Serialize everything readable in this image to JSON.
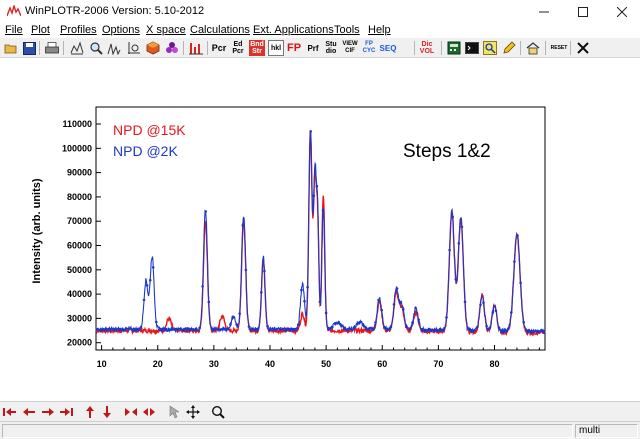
{
  "window": {
    "title": "WinPLOTR-2006 Version: 5.10-2012",
    "controls": [
      "minimize",
      "maximize",
      "close"
    ]
  },
  "menu": [
    {
      "label": "File"
    },
    {
      "label": "Plot"
    },
    {
      "label": "Profiles"
    },
    {
      "label": "Options"
    },
    {
      "label": "X space"
    },
    {
      "label": "Calculations"
    },
    {
      "label": "Ext. Applications"
    },
    {
      "label": "Tools"
    },
    {
      "label": "Help"
    }
  ],
  "toolbar": {
    "buttons": [
      {
        "name": "open-icon"
      },
      {
        "name": "save-icon"
      },
      {
        "name": "print-icon"
      },
      {
        "name": "zoom-graph-icon"
      },
      {
        "name": "zoom-icon"
      },
      {
        "name": "peaks-icon"
      },
      {
        "name": "cube-icon"
      },
      {
        "name": "molecule-icon"
      },
      {
        "name": "bars-icon"
      },
      {
        "name": "pcr-icon",
        "text": "Pcr"
      },
      {
        "name": "edit-pcr-icon",
        "text": "Ed Pcr"
      },
      {
        "name": "bond-str-icon",
        "text": "Bnd Str"
      },
      {
        "name": "hkl-icon",
        "text": "hkl"
      },
      {
        "name": "fp-icon",
        "text": "FP"
      },
      {
        "name": "prf-icon",
        "text": "Prf"
      },
      {
        "name": "studio-icon",
        "text": "Stu dio"
      },
      {
        "name": "view-cif-icon",
        "text": "VIEW CIF"
      },
      {
        "name": "fp-cyc-icon",
        "text": "FP CYC"
      },
      {
        "name": "seq-icon",
        "text": "SEQ"
      },
      {
        "name": "dic-vol-icon",
        "text": "Dic VOL"
      },
      {
        "name": "calculator-icon"
      },
      {
        "name": "terminal-icon"
      },
      {
        "name": "search-icon"
      },
      {
        "name": "pencil-icon"
      },
      {
        "name": "home-icon"
      },
      {
        "name": "reset-icon",
        "text": "RESET"
      },
      {
        "name": "close-x-icon"
      }
    ]
  },
  "chart_data": {
    "type": "line",
    "ylabel": "Intensity (arb. units)",
    "xlabel": "",
    "xlim": [
      9,
      89
    ],
    "ylim": [
      17000,
      117000
    ],
    "xticks": [
      10,
      20,
      30,
      40,
      50,
      60,
      70,
      80
    ],
    "yticks": [
      20000,
      30000,
      40000,
      50000,
      60000,
      70000,
      80000,
      90000,
      100000,
      110000
    ],
    "grid": false,
    "annotation": "Steps 1&2",
    "legend_position": "top-left",
    "series": [
      {
        "name": "NPD @15K",
        "color": "#e8161c",
        "baseline": 25000,
        "peaks": [
          [
            28.5,
            45000,
            0.35
          ],
          [
            35.3,
            46000,
            0.35
          ],
          [
            38.8,
            30000,
            0.3
          ],
          [
            45.8,
            7000,
            0.35
          ],
          [
            47.2,
            82000,
            0.28
          ],
          [
            48.0,
            62000,
            0.25
          ],
          [
            48.5,
            42000,
            0.22
          ],
          [
            49.5,
            56000,
            0.25
          ],
          [
            59.5,
            12000,
            0.4
          ],
          [
            62.5,
            16000,
            0.4
          ],
          [
            63.5,
            9000,
            0.4
          ],
          [
            66.0,
            8000,
            0.4
          ],
          [
            72.4,
            49000,
            0.45
          ],
          [
            74.0,
            46000,
            0.45
          ],
          [
            77.8,
            15000,
            0.4
          ],
          [
            80.0,
            11000,
            0.4
          ],
          [
            84.0,
            40000,
            0.55
          ],
          [
            22.0,
            5000,
            0.4
          ],
          [
            31.5,
            6000,
            0.4
          ]
        ]
      },
      {
        "name": "NPD @2K",
        "color": "#1c39c9",
        "baseline": 25500,
        "peaks": [
          [
            17.9,
            20000,
            0.35
          ],
          [
            19.0,
            30000,
            0.35
          ],
          [
            28.5,
            49000,
            0.35
          ],
          [
            35.3,
            47000,
            0.35
          ],
          [
            38.8,
            30000,
            0.3
          ],
          [
            45.8,
            19000,
            0.35
          ],
          [
            47.2,
            82000,
            0.28
          ],
          [
            48.0,
            64000,
            0.25
          ],
          [
            48.5,
            44000,
            0.22
          ],
          [
            49.5,
            50000,
            0.25
          ],
          [
            33.5,
            5000,
            0.4
          ],
          [
            59.5,
            13000,
            0.4
          ],
          [
            62.5,
            17000,
            0.4
          ],
          [
            63.5,
            10000,
            0.4
          ],
          [
            66.0,
            9000,
            0.4
          ],
          [
            72.4,
            49000,
            0.45
          ],
          [
            74.0,
            47000,
            0.45
          ],
          [
            77.8,
            14000,
            0.4
          ],
          [
            80.0,
            10000,
            0.4
          ],
          [
            84.0,
            40000,
            0.55
          ],
          [
            52.0,
            3000,
            0.6
          ],
          [
            56.0,
            3000,
            0.6
          ]
        ]
      }
    ]
  },
  "bottom_toolbar": {
    "buttons": [
      {
        "name": "first-arrow-icon"
      },
      {
        "name": "left-arrow-icon"
      },
      {
        "name": "right-arrow-icon"
      },
      {
        "name": "last-arrow-icon"
      },
      {
        "name": "up-arrow-icon"
      },
      {
        "name": "down-arrow-icon"
      },
      {
        "name": "shrink-icon"
      },
      {
        "name": "expand-icon"
      },
      {
        "name": "pointer-icon"
      },
      {
        "name": "move-icon"
      },
      {
        "name": "magnifier-icon"
      }
    ]
  },
  "status": {
    "mode": "multi"
  }
}
